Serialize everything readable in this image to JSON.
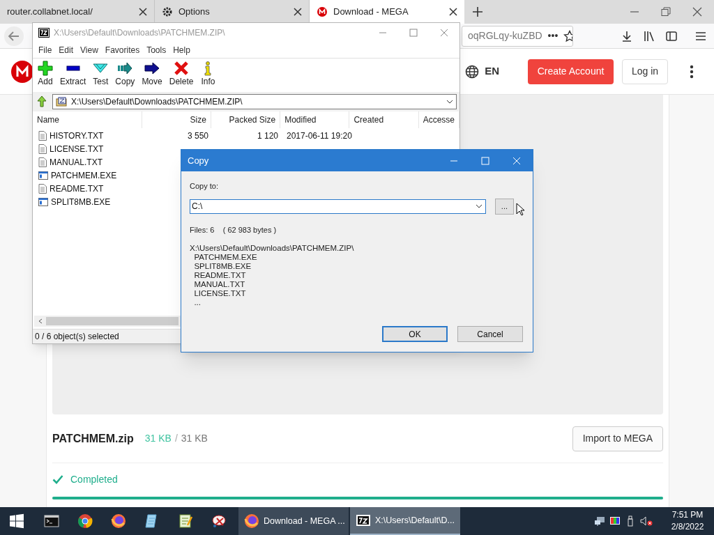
{
  "browser": {
    "tabs": [
      {
        "label": "router.collabnet.local/",
        "kind": "plain",
        "selected": false
      },
      {
        "label": "Options",
        "kind": "settings",
        "selected": false
      },
      {
        "label": "Download - MEGA",
        "kind": "mega",
        "selected": true
      }
    ],
    "address": "oqRGLqy-kuZBD",
    "page_actions": "•••"
  },
  "mega": {
    "language": "EN",
    "create_account": "Create Account",
    "login": "Log in",
    "file_name": "PATCHMEM.zip",
    "downloaded": "31 KB",
    "separator": "/",
    "total": "31 KB",
    "import_button": "Import to MEGA",
    "status": "Completed",
    "progress": {
      "level": 1
    }
  },
  "sevenzip": {
    "title": "X:\\Users\\Default\\Downloads\\PATCHMEM.ZIP\\",
    "menu": [
      "File",
      "Edit",
      "View",
      "Favorites",
      "Tools",
      "Help"
    ],
    "toolbar": [
      {
        "label": "Add",
        "kind": "add"
      },
      {
        "label": "Extract",
        "kind": "extract"
      },
      {
        "label": "Test",
        "kind": "test"
      },
      {
        "label": "Copy",
        "kind": "copy"
      },
      {
        "label": "Move",
        "kind": "move"
      },
      {
        "label": "Delete",
        "kind": "delete"
      },
      {
        "label": "Info",
        "kind": "info"
      }
    ],
    "path": "X:\\Users\\Default\\Downloads\\PATCHMEM.ZIP\\",
    "columns": [
      "Name",
      "Size",
      "Packed Size",
      "Modified",
      "Created",
      "Accesse"
    ],
    "rows": [
      {
        "name": "HISTORY.TXT",
        "kind": "text",
        "size": "3 550",
        "packed": "1 120",
        "modified": "2017-06-11 19:20"
      },
      {
        "name": "LICENSE.TXT",
        "kind": "text"
      },
      {
        "name": "MANUAL.TXT",
        "kind": "text"
      },
      {
        "name": "PATCHMEM.EXE",
        "kind": "program"
      },
      {
        "name": "README.TXT",
        "kind": "text"
      },
      {
        "name": "SPLIT8MB.EXE",
        "kind": "program"
      }
    ],
    "status": "0 / 6 object(s) selected"
  },
  "copy_dialog": {
    "title": "Copy",
    "label": "Copy to:",
    "value": "C:\\",
    "browse": "...",
    "summary": "Files: 6    ( 62 983 bytes )",
    "listing": [
      "X:\\Users\\Default\\Downloads\\PATCHMEM.ZIP\\",
      "  PATCHMEM.EXE",
      "  SPLIT8MB.EXE",
      "  README.TXT",
      "  MANUAL.TXT",
      "  LICENSE.TXT",
      "  ..."
    ],
    "ok": "OK",
    "cancel": "Cancel"
  },
  "taskbar": {
    "windows": [
      {
        "label": "Download - MEGA ...",
        "kind": "browser",
        "selected": false
      },
      {
        "label": "X:\\Users\\Default\\D...",
        "kind": "archiver",
        "selected": true
      }
    ],
    "time": "7:51 PM",
    "date": "2/8/2022"
  }
}
